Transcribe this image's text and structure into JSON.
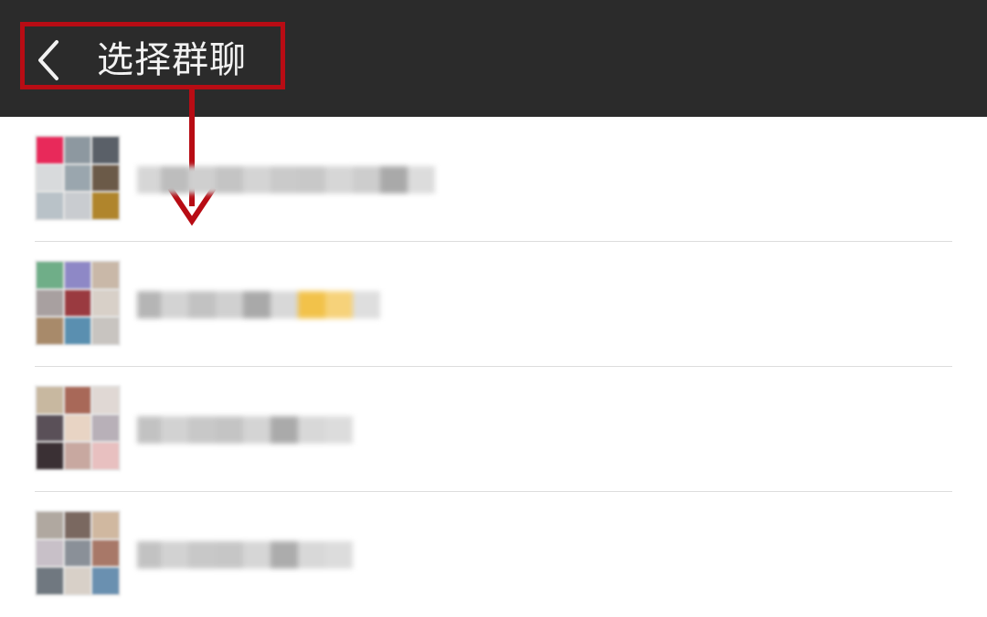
{
  "header": {
    "title": "选择群聊",
    "back_icon": "chevron-left-icon",
    "background": "#2b2b2b",
    "highlight_color": "#b80c14"
  },
  "groups": [
    {
      "avatar_colors": [
        "#e8295a",
        "#8d98a0",
        "#5a6068",
        "#d8dadc",
        "#9aa6ae",
        "#6b5a48",
        "#b9c2c8",
        "#c9ccd0",
        "#b0852c"
      ],
      "name_blocks": [
        "#d6d6d6",
        "#bdbdbd",
        "#cfcfcf",
        "#c4c4c4",
        "#d4d4d4",
        "#cacaca",
        "#c8c8c8",
        "#d6d6d6",
        "#cdcdcd",
        "#a9a9a9",
        "#dcdcdc"
      ],
      "name_blurred": true
    },
    {
      "avatar_colors": [
        "#6fae88",
        "#8e88c6",
        "#c9b8a8",
        "#a8a0a0",
        "#9a3a40",
        "#d8d0c8",
        "#a88a6a",
        "#5a8fb0",
        "#c8c4c0"
      ],
      "name_blocks": [
        "#b5b5b5",
        "#d3d3d3",
        "#c2c2c2",
        "#d0d0d0",
        "#a9a9a9",
        "#d8d8d8",
        "#f2c24a",
        "#f6d27a",
        "#dedede"
      ],
      "name_blurred": true
    },
    {
      "avatar_colors": [
        "#c8b8a0",
        "#a86858",
        "#e0d8d4",
        "#5a5058",
        "#e8d4c4",
        "#b8b0b8",
        "#3a3034",
        "#c8a8a0",
        "#e8c0c0"
      ],
      "name_blocks": [
        "#c2c2c2",
        "#d2d2d2",
        "#c8c8c8",
        "#c4c4c4",
        "#d4d4d4",
        "#aaaaaa",
        "#d8d8d8",
        "#dcdcdc"
      ],
      "name_blurred": true
    },
    {
      "avatar_colors": [
        "#b0a8a0",
        "#7a6860",
        "#d0b8a0",
        "#c8c0c8",
        "#8a9098",
        "#a87868",
        "#707880",
        "#d8d0c8",
        "#6a90b0"
      ],
      "name_blocks": [
        "#c2c2c2",
        "#d2d2d2",
        "#c8c8c8",
        "#c6c6c6",
        "#d6d6d6",
        "#acacac",
        "#d8d8d8",
        "#dcdcdc"
      ],
      "name_blurred": true
    }
  ]
}
